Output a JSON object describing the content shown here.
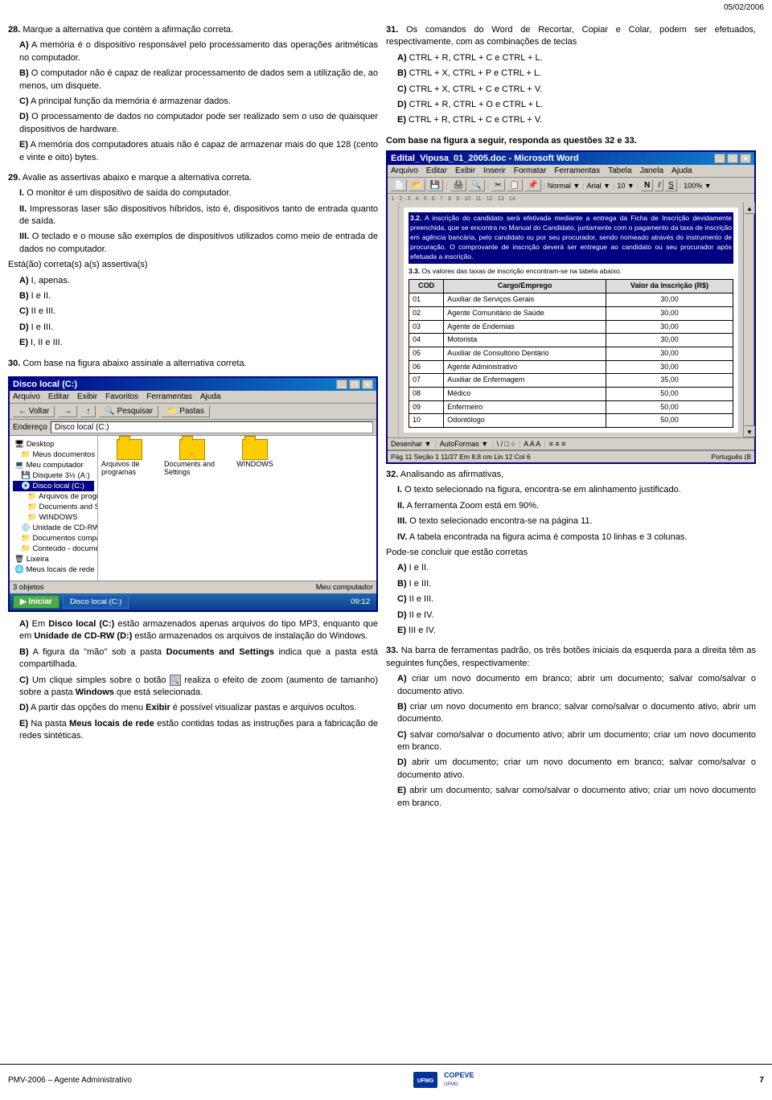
{
  "header": {
    "date": "05/02/2006"
  },
  "left_column": {
    "q28": {
      "number": "28.",
      "text": "Marque a alternativa que contém a afirmação correta.",
      "options": [
        {
          "label": "A)",
          "text": "A memória é o dispositivo responsável pelo processamento das operações aritméticas no computador."
        },
        {
          "label": "B)",
          "text": "O computador não é capaz de realizar processamento de dados sem a utilização de, ao menos, um disquete."
        },
        {
          "label": "C)",
          "text": "A principal função da memória é armazenar dados."
        },
        {
          "label": "D)",
          "text": "O processamento de dados no computador pode ser realizado sem o uso de quaisquer dispositivos de hardware."
        },
        {
          "label": "E)",
          "text": "A memória dos computadores atuais não é capaz de armazenar mais do que 128 (cento e vinte e oito) bytes."
        }
      ]
    },
    "q29": {
      "number": "29.",
      "text": "Avalie as assertivas abaixo e marque a alternativa correta.",
      "assertions": [
        {
          "roman": "I.",
          "text": "O monitor é um dispositivo de saída do computador."
        },
        {
          "roman": "II.",
          "text": "Impressoras laser são dispositivos híbridos, isto é, dispositivos tanto de entrada quanto de saída."
        },
        {
          "roman": "III.",
          "text": "O teclado e o mouse são exemplos de dispositivos utilizados como meio de entrada de dados no computador."
        }
      ],
      "prefix": "Está(ão) correta(s) a(s) assertiva(s)",
      "options": [
        {
          "label": "A)",
          "text": "I, apenas."
        },
        {
          "label": "B)",
          "text": "I e II."
        },
        {
          "label": "C)",
          "text": "II e III."
        },
        {
          "label": "D)",
          "text": "I e III."
        },
        {
          "label": "E)",
          "text": "I, II e III."
        }
      ]
    },
    "q30": {
      "number": "30.",
      "text": "Com base na figura abaixo assinale a alternativa correta.",
      "explorer": {
        "title": "Disco local (C:)",
        "menu_items": [
          "Arquivo",
          "Editar",
          "Exibir",
          "Favoritos",
          "Ferramentas",
          "Ajuda"
        ],
        "address": "Disco local (C:)",
        "tree_items": [
          {
            "text": "Desktop",
            "indent": 0
          },
          {
            "text": "Meus documentos",
            "indent": 1
          },
          {
            "text": "Meu computador",
            "indent": 0,
            "selected": true
          },
          {
            "text": "Disquete 3½ (A:)",
            "indent": 1
          },
          {
            "text": "Disco local (C:)",
            "indent": 1,
            "selected": true
          },
          {
            "text": "Arquivos de programas",
            "indent": 2
          },
          {
            "text": "Documents and Settings",
            "indent": 2
          },
          {
            "text": "WINDOWS",
            "indent": 2
          },
          {
            "text": "Unidade de CD-RW (D:)",
            "indent": 1
          },
          {
            "text": "Documentos compartilhados",
            "indent": 1
          },
          {
            "text": "Conteúdo - documentos",
            "indent": 1
          },
          {
            "text": "Lixeira",
            "indent": 0
          },
          {
            "text": "Meus locais de rede",
            "indent": 0
          }
        ],
        "files": [
          "Arquivos de programas",
          "Documents and Settings",
          "WINDOWS"
        ],
        "status": "3 objetos",
        "taskbar_item": "Disco local (C:)",
        "time": "09:12"
      },
      "options": [
        {
          "label": "A)",
          "text": "Em Disco local (C:) estão armazenados apenas arquivos do tipo MP3, enquanto que em Unidade de CD-RW (D:) estão armazenados os arquivos de instalação do Windows."
        },
        {
          "label": "B)",
          "text": "A figura da \"mão\" sob a pasta Documents and Settings indica que a pasta está compartilhada."
        },
        {
          "label": "C)",
          "text": "Um clique simples sobre o botão [ícone] realiza o efeito de zoom (aumento de tamanho) sobre a pasta Windows que está selecionada."
        },
        {
          "label": "D)",
          "text": "A partir das opções do menu Exibir é possível visualizar pastas e arquivos ocultos."
        },
        {
          "label": "E)",
          "text": "Na pasta Meus locais de rede estão contidas todas as instruções para a fabricação de redes sintéticas."
        }
      ]
    }
  },
  "right_column": {
    "q31": {
      "number": "31.",
      "intro": "Os comandos do Word de Recortar, Copiar e Colar, podem ser efetuados, respectivamente, com as combinações de teclas",
      "options": [
        {
          "label": "A)",
          "text": "CTRL + R, CTRL + C e CTRL + L."
        },
        {
          "label": "B)",
          "text": "CTRL + X, CTRL + P e CTRL + L."
        },
        {
          "label": "C)",
          "text": "CTRL + X, CTRL + C e CTRL + V."
        },
        {
          "label": "D)",
          "text": "CTRL + R, CTRL + O e CTRL + L."
        },
        {
          "label": "E)",
          "text": "CTRL + R, CTRL + C e CTRL + V."
        }
      ]
    },
    "q3233_intro": "Com base na figura a seguir, responda as questões 32 e 33.",
    "word_window": {
      "title": "Edital_Vipusa_01_2005.doc - Microsoft Word",
      "menu_items": [
        "Arquivo",
        "Editar",
        "Exibir",
        "Inserir",
        "Formatar",
        "Ferramentas",
        "Tabela",
        "Janela",
        "Ajuda"
      ],
      "font": "Arial",
      "size": "10",
      "zoom": "100%",
      "page_info": "Pág 11   Seção 1   11/27   Em 8,8 cm   Lin 12   Col 6",
      "language": "Português (B",
      "para3_2": "3.2.",
      "para3_2_text": "A inscrição do candidato será efetivada mediante a entrega da Ficha de Inscrição devidamente preenchida, que se encontra no Manual do Candidato, juntamente com o pagamento da taxa de inscrição em agência bancária, pelo candidato ou por seu procurador, sendo nomeado através do instrumento de procuração. O comprovante de inscrição deverá ser entregue ao candidato ou seu procurador após efetuada a inscrição.",
      "para3_3": "3.3.",
      "para3_3_text": "Os valores das taxas de inscrição encontram-se na tabela abaixo.",
      "table": {
        "headers": [
          "COD",
          "Cargo/Emprego",
          "Valor da Inscrição (R$)"
        ],
        "rows": [
          [
            "01",
            "Auxiliar de Serviços Gerais",
            "30,00"
          ],
          [
            "02",
            "Agente Comunitário de Saúde",
            "30,00"
          ],
          [
            "03",
            "Agente de Endemias",
            "30,00"
          ],
          [
            "04",
            "Motorista",
            "30,00"
          ],
          [
            "05",
            "Auxiliar de Consultório Dentário",
            "30,00"
          ],
          [
            "06",
            "Agente Administrativo",
            "30,00"
          ],
          [
            "07",
            "Auxiliar de Enfermagem",
            "35,00"
          ],
          [
            "08",
            "Médico",
            "50,00"
          ],
          [
            "09",
            "Enfermeiro",
            "50,00"
          ],
          [
            "10",
            "Odontólogo",
            "50,00"
          ]
        ]
      },
      "draw_toolbar": "Desenhar ▼   AutoFormas ▼"
    },
    "q32": {
      "number": "32.",
      "text": "Analisando as afirmativas,",
      "assertions": [
        {
          "roman": "I.",
          "text": "O texto selecionado na figura, encontra-se em alinhamento justificado."
        },
        {
          "roman": "II.",
          "text": "A ferramenta Zoom está em 90%."
        },
        {
          "roman": "III.",
          "text": "O texto selecionado encontra-se na página 11."
        },
        {
          "roman": "IV.",
          "text": "A tabela encontrada na figura acima é composta 10 linhas e 3 colunas."
        }
      ],
      "prefix": "Pode-se concluir que estão corretas",
      "options": [
        {
          "label": "A)",
          "text": "I e II."
        },
        {
          "label": "B)",
          "text": "I e III."
        },
        {
          "label": "C)",
          "text": "II e III."
        },
        {
          "label": "D)",
          "text": "II e IV."
        },
        {
          "label": "E)",
          "text": "III e IV."
        }
      ]
    },
    "q33": {
      "number": "33.",
      "text": "Na barra de ferramentas padrão, os três botões iniciais da esquerda para a direita têm as seguintes funções, respectivamente:",
      "options": [
        {
          "label": "A)",
          "text": "criar um novo documento em branco; abrir um documento; salvar como/salvar o documento ativo."
        },
        {
          "label": "B)",
          "text": "criar um novo documento em branco; salvar como/salvar o documento ativo, abrir um documento."
        },
        {
          "label": "C)",
          "text": "salvar como/salvar o documento ativo; abrir um documento; criar um novo documento em branco."
        },
        {
          "label": "D)",
          "text": "abrir um documento; criar um novo documento em branco; salvar como/salvar o documento ativo."
        },
        {
          "label": "E)",
          "text": "abrir um documento; salvar como/salvar o documento ativo; criar um novo documento em branco."
        }
      ]
    }
  },
  "footer": {
    "left": "PMV-2006 – Agente Administrativo",
    "logo_text": "COPEVE",
    "page_number": "7"
  }
}
